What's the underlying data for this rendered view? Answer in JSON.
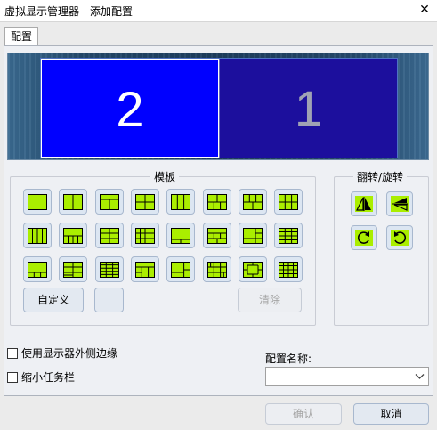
{
  "window": {
    "title": "虚拟显示管理器 - 添加配置",
    "close_glyph": "✕"
  },
  "tabs": [
    {
      "label": "配置"
    }
  ],
  "preview": {
    "monitors": [
      {
        "label": "2",
        "color": "#0000ff",
        "selected": true
      },
      {
        "label": "1",
        "color": "#1c0f9d",
        "selected": false
      }
    ]
  },
  "templates": {
    "title": "模板",
    "fill_color": "#aaee00",
    "items": [
      {
        "name": "single"
      },
      {
        "name": "two-columns"
      },
      {
        "name": "top-two-bottom-one"
      },
      {
        "name": "two-by-two"
      },
      {
        "name": "three-columns"
      },
      {
        "name": "top-two-bottom-three"
      },
      {
        "name": "top-three-bottom-two"
      },
      {
        "name": "two-rows-three-columns"
      },
      {
        "name": "four-columns"
      },
      {
        "name": "top-one-bottom-four"
      },
      {
        "name": "three-rows-two-columns"
      },
      {
        "name": "three-rows-four-columns-left"
      },
      {
        "name": "wide-top-narrow-bottom"
      },
      {
        "name": "five-panel-mixed"
      },
      {
        "name": "big-left-stacked-right"
      },
      {
        "name": "four-by-three"
      },
      {
        "name": "big-top-three-bottom"
      },
      {
        "name": "large-center-corners"
      },
      {
        "name": "five-rows-three-columns"
      },
      {
        "name": "top-wide-bottom-split"
      },
      {
        "name": "big-left-two-right"
      },
      {
        "name": "center-focus-grid"
      },
      {
        "name": "framed-center"
      },
      {
        "name": "four-by-four"
      }
    ],
    "custom_label": "自定义",
    "clear_label": "清除"
  },
  "flip": {
    "title": "翻转/旋转",
    "items": [
      {
        "name": "flip-horizontal"
      },
      {
        "name": "flip-vertical"
      },
      {
        "name": "rotate-clockwise"
      },
      {
        "name": "rotate-counterclockwise"
      }
    ]
  },
  "options": {
    "use_outer_edge": {
      "label": "使用显示器外侧边缘",
      "checked": false
    },
    "shrink_taskbar": {
      "label": "缩小任务栏",
      "checked": false
    }
  },
  "config_name": {
    "label": "配置名称:",
    "value": ""
  },
  "buttons": {
    "ok": "确认",
    "cancel": "取消"
  }
}
